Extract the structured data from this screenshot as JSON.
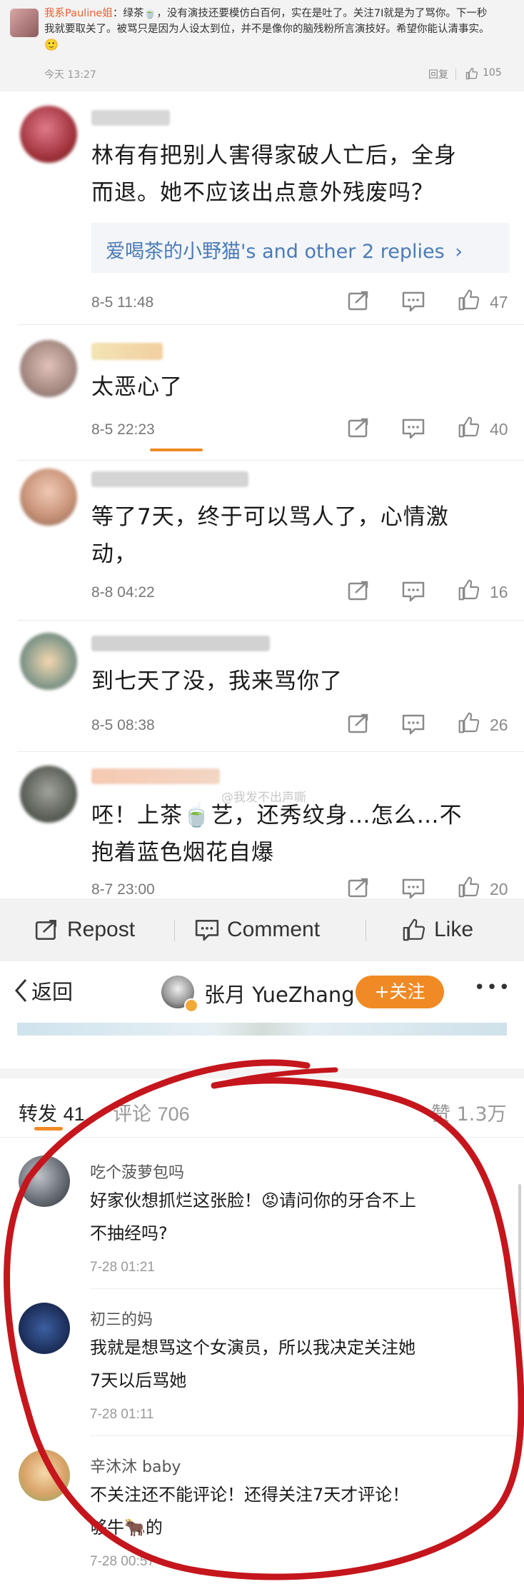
{
  "top_post": {
    "author": "我系Pauline姐",
    "text_line1": "：绿茶🍵，没有演技还要模仿白百何，实在是吐了。关注7I就是为了骂你。下一秒",
    "text_line2": "我就要取关了。被骂只是因为人设太到位，并不是像你的脑残粉所言演技好。希望你能认清事实。",
    "emoji": "🙂",
    "time": "今天 13:27",
    "reply_label": "回复",
    "like_count": "105"
  },
  "comments": [
    {
      "text_line1": "林有有把别人害得家破人亡后，全身",
      "text_line2": "而退。她不应该出点意外残废吗？",
      "time": "8-5 11:48",
      "likes": "47",
      "reply_user": "爱喝茶的小野猫",
      "reply_mid": "'s and ",
      "reply_other": "other 2 replies",
      "reply_arrow": "›"
    },
    {
      "text_line1": "太恶心了",
      "time": "8-5 22:23",
      "likes": "40"
    },
    {
      "text_line1": "等了7天，终于可以骂人了，心情激",
      "text_line2": "动，",
      "time": "8-8 04:22",
      "likes": "16"
    },
    {
      "text_line1": "到七天了没，我来骂你了",
      "time": "8-5 08:38",
      "likes": "26"
    },
    {
      "text_line1": "呸！上茶🍵艺，还秀纹身…怎么…不",
      "text_line2": "抱着蓝色烟花自爆",
      "time": "8-7 23:00",
      "likes": "20"
    }
  ],
  "watermark": "@我发不出声嘶",
  "action_bar": {
    "repost": "Repost",
    "comment": "Comment",
    "like": "Like"
  },
  "nav": {
    "back_label": "返回",
    "user_name": "张月 YueZhang",
    "follow_label": "+关注",
    "more": "•••"
  },
  "tabs": {
    "repost_label": "转发",
    "repost_count": "41",
    "comment_label": "评论",
    "comment_count": "706",
    "like_label": "赞",
    "like_count": "1.3万"
  },
  "bottom_comments": [
    {
      "name": "吃个菠萝包吗",
      "text_line1": "好家伙想抓烂这张脸！😡请问你的牙合不上",
      "text_line2": "不抽经吗?",
      "time": "7-28 01:21"
    },
    {
      "name": "初三的妈",
      "text_line1": "我就是想骂这个女演员，所以我决定关注她",
      "text_line2": "7天以后骂她",
      "time": "7-28 01:11"
    },
    {
      "name": "辛沐沐 baby",
      "text_line1": "不关注还不能评论！还得关注7天才评论！",
      "text_line2": "够牛🐂的",
      "time": "7-28 00:57"
    }
  ],
  "colors": {
    "link": "#4a7bb7",
    "orange": "#f08a24",
    "annotation_red": "#c4161c",
    "top_author": "#e8612c"
  }
}
